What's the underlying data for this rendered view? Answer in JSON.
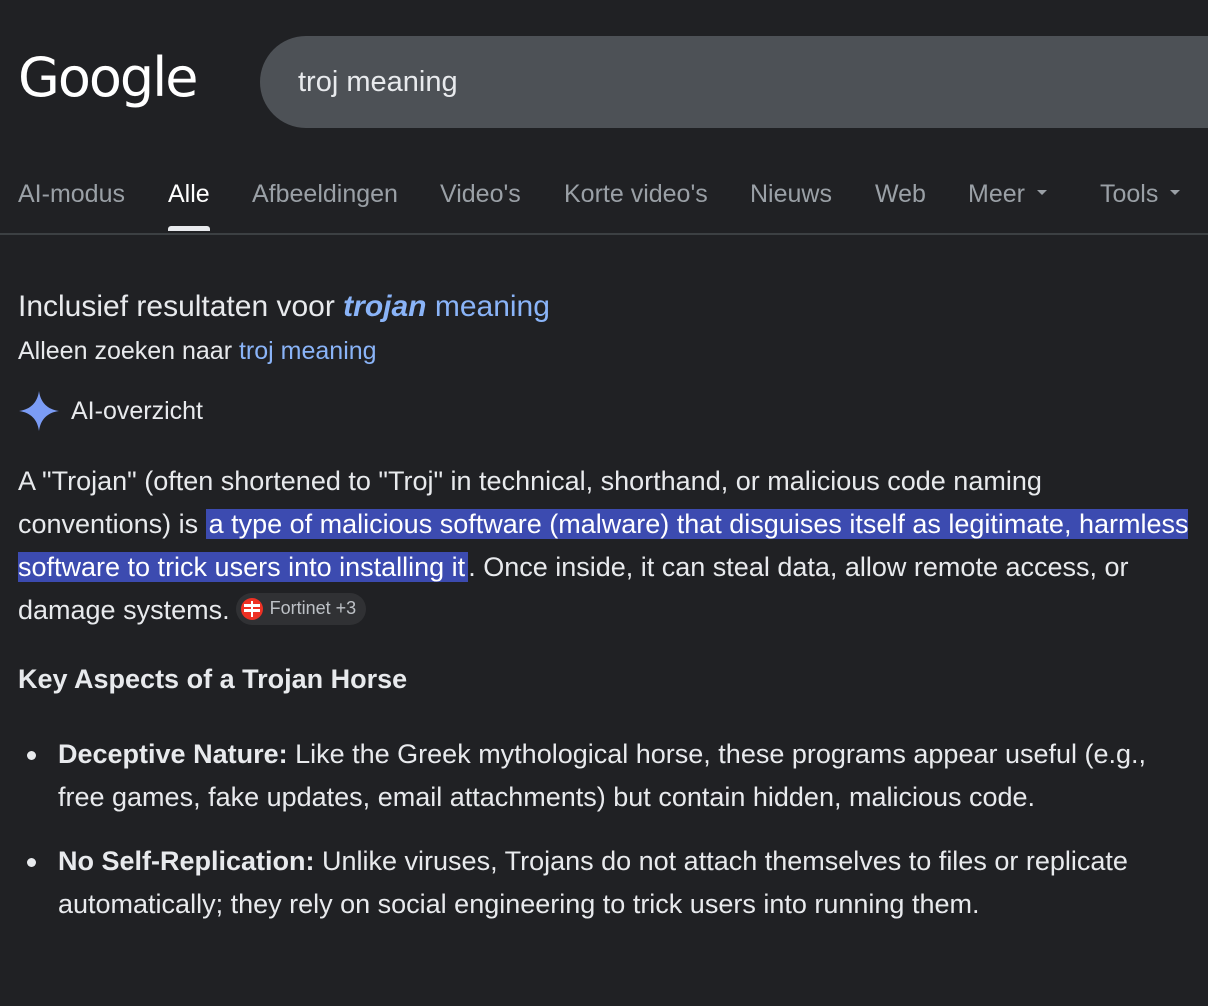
{
  "logo": {
    "text": "Google"
  },
  "search": {
    "query": "troj meaning"
  },
  "tabs": [
    {
      "label": "AI-modus",
      "active": false
    },
    {
      "label": "Alle",
      "active": true
    },
    {
      "label": "Afbeeldingen",
      "active": false
    },
    {
      "label": "Video's",
      "active": false
    },
    {
      "label": "Korte video's",
      "active": false
    },
    {
      "label": "Nieuws",
      "active": false
    },
    {
      "label": "Web",
      "active": false
    },
    {
      "label": "Meer",
      "active": false
    },
    {
      "label": "Tools",
      "active": false
    }
  ],
  "spelling": {
    "prefix": "Inclusief resultaten voor ",
    "corrected_word": "trojan",
    "corrected_rest": " meaning",
    "only_prefix": "Alleen zoeken naar ",
    "only_link": "troj meaning"
  },
  "ai_overview": {
    "label": "AI-overzicht",
    "intro_before": "A \"Trojan\" (often shortened to \"Troj\" in technical, shorthand, or malicious code naming conventions) is ",
    "intro_highlight": "a type of malicious software (malware) that disguises itself as legitimate, harmless software to trick users into installing it",
    "intro_after": ". Once inside, it can steal data, allow remote access, or damage systems.",
    "source_chip": "Fortinet +3",
    "key_heading": "Key Aspects of a Trojan Horse",
    "bullets": [
      {
        "title": "Deceptive Nature:",
        "text": " Like the Greek mythological horse, these programs appear useful (e.g., free games, fake updates, email attachments) but contain hidden, malicious code."
      },
      {
        "title": "No Self-Replication:",
        "text": " Unlike viruses, Trojans do not attach themselves to files or replicate automatically; they rely on social engineering to trick users into running them."
      }
    ]
  },
  "colors": {
    "background": "#202124",
    "search_box": "#4d5156",
    "link": "#8ab4f8",
    "highlight": "#3c4bb0",
    "sparkle": "#7b9cf5"
  }
}
